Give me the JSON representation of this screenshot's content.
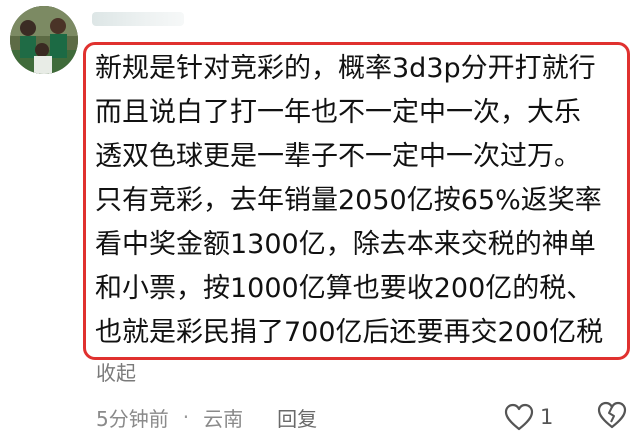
{
  "comment": {
    "lines": [
      "新规是针对竞彩的，概率3d3p分开打就行",
      "而且说白了打一年也不一定中一次，大乐",
      "透双色球更是一辈子不一定中一次过万。",
      "只有竞彩，去年销量2050亿按65%返奖率",
      "看中奖金额1300亿，除去本来交税的神单",
      "和小票，按1000亿算也要收200亿的税、",
      "也就是彩民捐了700亿后还要再交200亿税"
    ],
    "collapse_label": "收起",
    "time": "5分钟前",
    "separator": "·",
    "location": "云南",
    "reply_label": "回复",
    "like_count": "1",
    "highlight_color": "#e0312f"
  },
  "icons": {
    "like": "heart-outline-icon",
    "dislike": "broken-heart-icon"
  }
}
